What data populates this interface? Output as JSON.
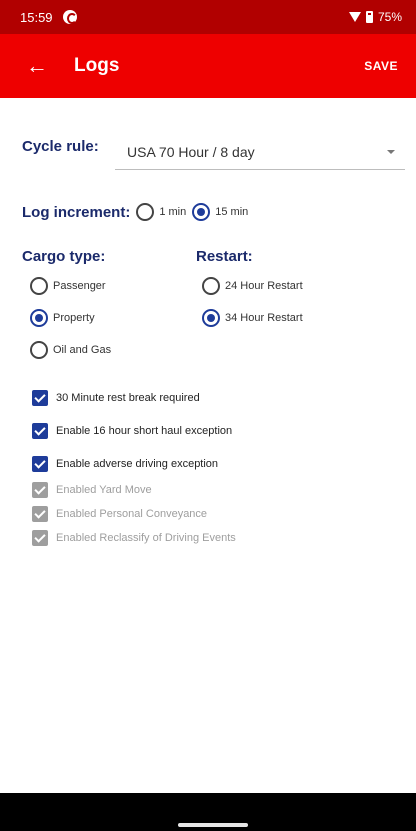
{
  "status_bar": {
    "time": "15:59",
    "battery": "75%"
  },
  "app_bar": {
    "title": "Logs",
    "save_label": "SAVE"
  },
  "cycle": {
    "label": "Cycle rule:",
    "value": "USA 70 Hour / 8 day"
  },
  "increment": {
    "label": "Log increment:",
    "options": [
      {
        "label": "1 min",
        "selected": false
      },
      {
        "label": "15 min",
        "selected": true
      }
    ]
  },
  "cargo": {
    "label": "Cargo type:",
    "options": [
      {
        "label": "Passenger",
        "selected": false
      },
      {
        "label": "Property",
        "selected": true
      },
      {
        "label": "Oil and Gas",
        "selected": false
      }
    ]
  },
  "restart": {
    "label": "Restart:",
    "options": [
      {
        "label": "24 Hour Restart",
        "selected": false
      },
      {
        "label": "34 Hour Restart",
        "selected": true
      }
    ]
  },
  "checks": [
    {
      "label": "30 Minute rest break required",
      "checked": true,
      "enabled": true
    },
    {
      "label": "Enable 16 hour short haul exception",
      "checked": true,
      "enabled": true
    },
    {
      "label": "Enable adverse driving exception",
      "checked": true,
      "enabled": true
    },
    {
      "label": "Enabled Yard Move",
      "checked": true,
      "enabled": false
    },
    {
      "label": "Enabled Personal Conveyance",
      "checked": true,
      "enabled": false
    },
    {
      "label": "Enabled Reclassify of Driving Events",
      "checked": true,
      "enabled": false
    }
  ],
  "colors": {
    "status_bar": "#b10000",
    "app_bar": "#ee0000",
    "accent": "#1e3c9a",
    "label": "#1b2a6b"
  }
}
